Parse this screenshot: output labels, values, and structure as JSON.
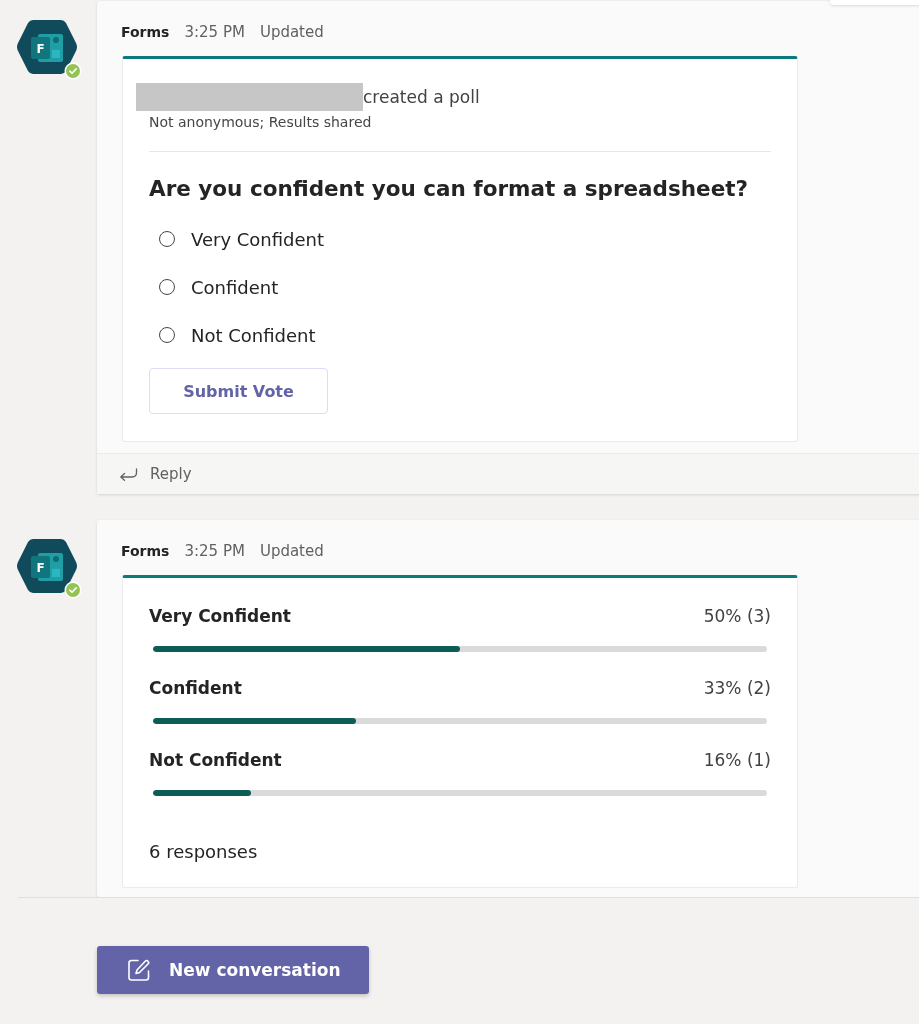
{
  "messages": [
    {
      "kind": "poll",
      "avatar_letter": "F",
      "online": true,
      "sender": "Forms",
      "time": "3:25 PM",
      "status": "Updated",
      "poll": {
        "creator_redacted": true,
        "created_text": "created a poll",
        "settings": "Not anonymous; Results shared",
        "question": "Are you confident you can format a spreadsheet?",
        "options": [
          {
            "label": "Very Confident",
            "selected": false
          },
          {
            "label": "Confident",
            "selected": false
          },
          {
            "label": "Not Confident",
            "selected": false
          }
        ],
        "submit": "Submit Vote"
      },
      "reply": "Reply"
    },
    {
      "kind": "results",
      "avatar_letter": "F",
      "online": true,
      "sender": "Forms",
      "time": "3:25 PM",
      "status": "Updated",
      "results": {
        "rows": [
          {
            "label": "Very Confident",
            "reading": "50% (3)",
            "level": 0.5
          },
          {
            "label": "Confident",
            "reading": "33% (2)",
            "level": 0.33
          },
          {
            "label": "Not Confident",
            "reading": "16% (1)",
            "level": 0.16
          }
        ],
        "total": "6 responses"
      }
    }
  ],
  "new_conversation_button": "New conversation"
}
